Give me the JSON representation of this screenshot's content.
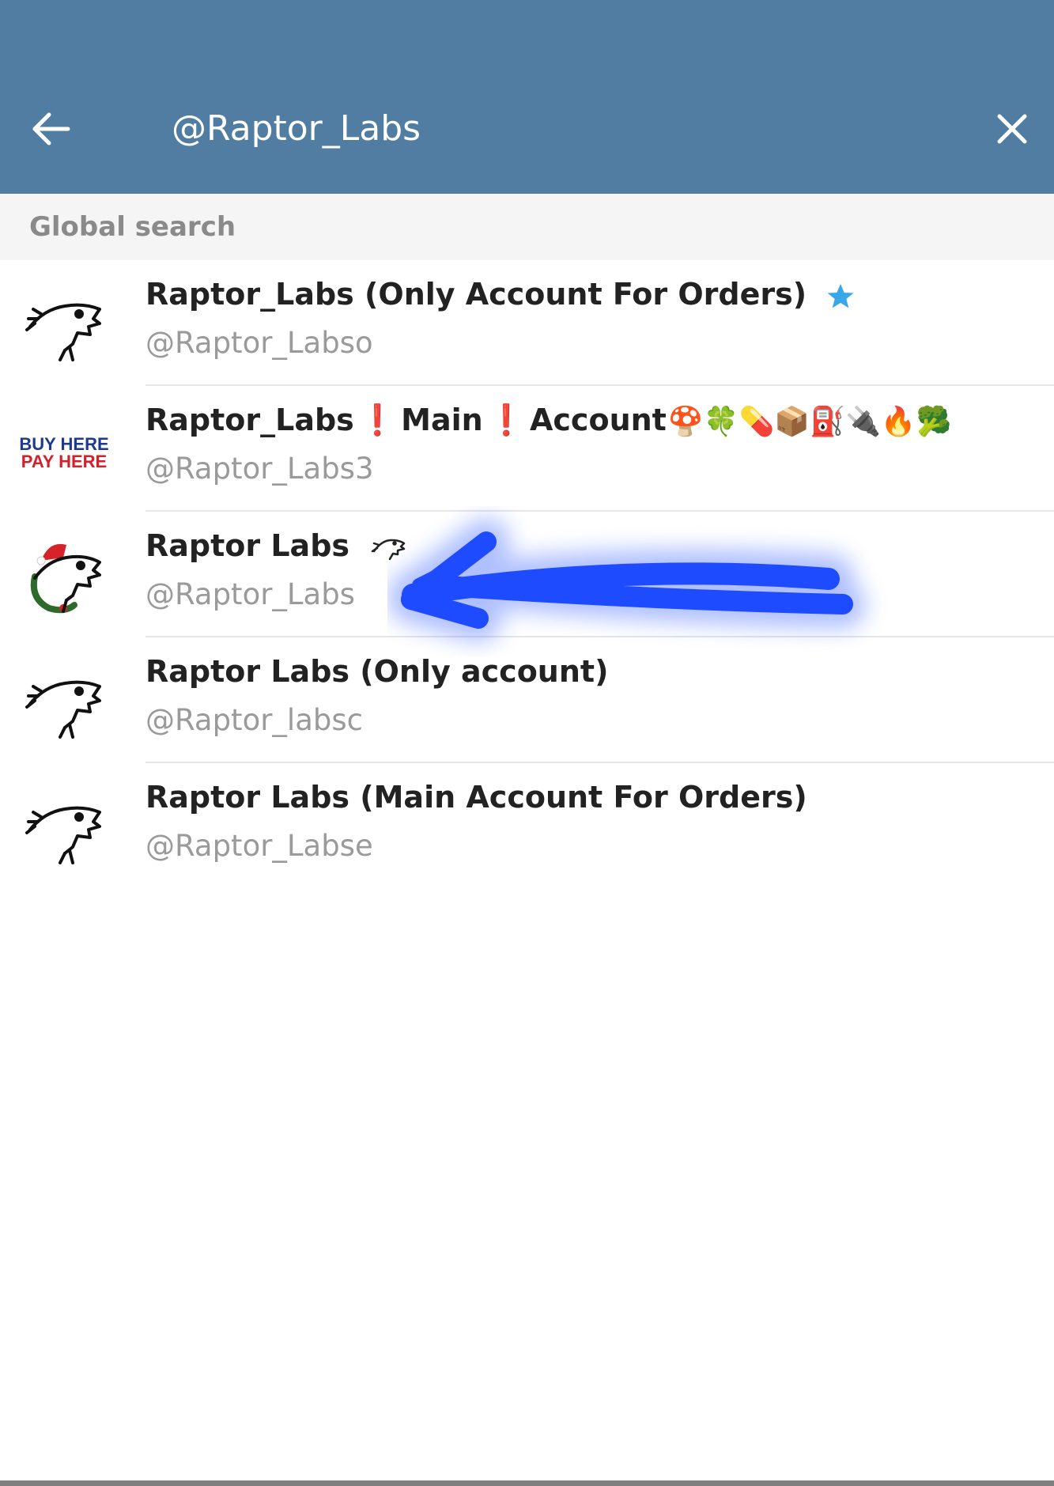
{
  "header": {
    "search_value": "@Raptor_Labs",
    "bg_color": "#527DA3",
    "back_icon": "back-arrow-icon",
    "close_icon": "close-icon"
  },
  "section": {
    "title": "Global search"
  },
  "results": [
    {
      "name": "Raptor_Labs (Only Account For Orders)",
      "username": "@Raptor_Labso",
      "badge_icon": "star-icon",
      "avatar": "raptor-logo"
    },
    {
      "name_part1": "Raptor_Labs",
      "name_sep1": "❗",
      "name_part2": "Main",
      "name_sep2": "❗",
      "name_part3": "Account",
      "name_emojis": "🍄🍀💊📦⛽🔌🔥🥦",
      "username": "@Raptor_Labs3",
      "avatar_line1": "BUY HERE",
      "avatar_line2": "PAY HERE"
    },
    {
      "name": "Raptor Labs",
      "username": "@Raptor_Labs",
      "badge_icon": "raptor-head-icon",
      "avatar": "raptor-santa-logo"
    },
    {
      "name": "Raptor Labs (Only account)",
      "username": "@Raptor_labsc",
      "avatar": "raptor-logo"
    },
    {
      "name": "Raptor Labs (Main Account For Orders)",
      "username": "@Raptor_Labse",
      "avatar": "raptor-logo"
    }
  ],
  "annotation": {
    "type": "hand-drawn-arrow",
    "color": "#1f4bff"
  }
}
